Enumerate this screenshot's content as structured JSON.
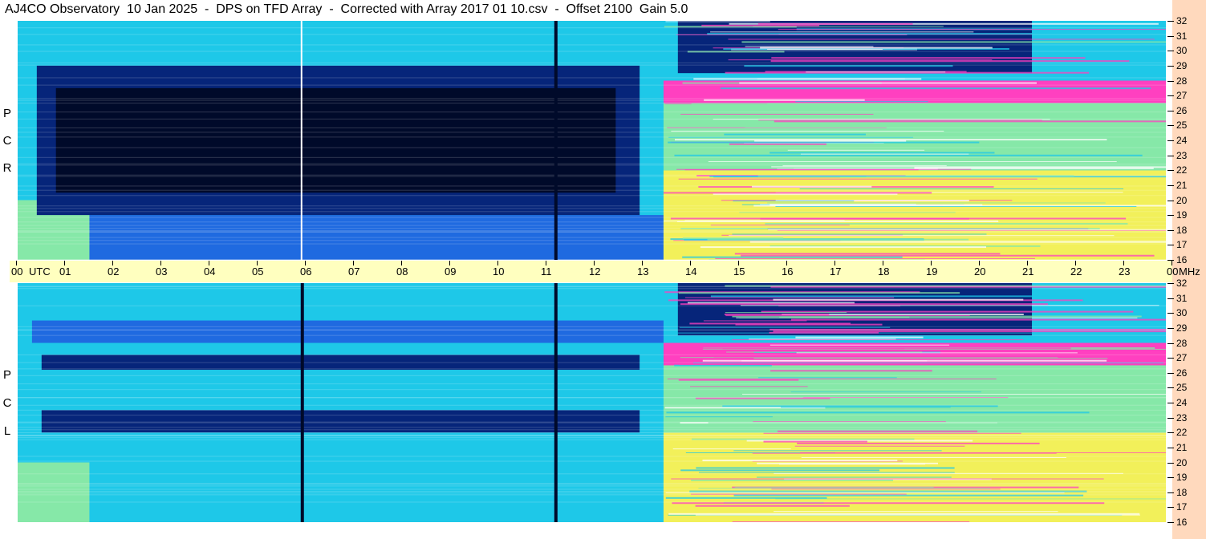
{
  "title": "AJ4CO Observatory  10 Jan 2025  -  DPS on TFD Array  -  Corrected with Array 2017 01 10.csv  -  Offset 2100  Gain 5.0",
  "polarizations": {
    "top": [
      "R",
      "C",
      "P"
    ],
    "bottom": [
      "L",
      "C",
      "P"
    ]
  },
  "time_axis": {
    "labels": [
      "00",
      "01",
      "02",
      "03",
      "04",
      "05",
      "06",
      "07",
      "08",
      "09",
      "10",
      "11",
      "12",
      "13",
      "14",
      "15",
      "16",
      "17",
      "18",
      "19",
      "20",
      "21",
      "22",
      "23",
      "00"
    ],
    "utc_label": "UTC",
    "mhz_label": "MHz"
  },
  "freq_axis": {
    "labels": [
      "32",
      "31",
      "30",
      "29",
      "28",
      "27",
      "26",
      "25",
      "24",
      "23",
      "22",
      "21",
      "20",
      "19",
      "18",
      "17",
      "16"
    ]
  },
  "colors": {
    "background_right": "#ffd9bd",
    "time_bar": "#ffffbf",
    "deep": "#000a2a",
    "dark": "#06257a",
    "blue": "#1f6ae0",
    "cyan": "#1ec8e8",
    "green": "#86e8a8",
    "yellow": "#f2f05a",
    "magenta": "#ff40c0",
    "white": "#ffffff"
  },
  "chart_data": {
    "type": "heatmap",
    "title": "AJ4CO Observatory  10 Jan 2025  -  DPS on TFD Array  -  Corrected with Array 2017 01 10.csv  -  Offset 2100  Gain 5.0",
    "xlabel": "UTC",
    "ylabel": "MHz",
    "x_range": [
      0,
      24
    ],
    "y_range": [
      16,
      32
    ],
    "panels": [
      {
        "name": "RCP",
        "regions": [
          {
            "x0": 0.0,
            "x1": 24.0,
            "y0": 16,
            "y1": 32,
            "level": "cyan"
          },
          {
            "x0": 0.0,
            "x1": 13.5,
            "y0": 16,
            "y1": 19,
            "level": "blue"
          },
          {
            "x0": 0.0,
            "x1": 1.5,
            "y0": 16,
            "y1": 20,
            "level": "green"
          },
          {
            "x0": 0.4,
            "x1": 13.0,
            "y0": 19,
            "y1": 29,
            "level": "dark"
          },
          {
            "x0": 0.8,
            "x1": 12.5,
            "y0": 20.5,
            "y1": 27.5,
            "level": "deep"
          },
          {
            "x0": 13.5,
            "x1": 24.0,
            "y0": 16,
            "y1": 22,
            "level": "yellow"
          },
          {
            "x0": 13.5,
            "x1": 24.0,
            "y0": 22,
            "y1": 26.5,
            "level": "green"
          },
          {
            "x0": 13.8,
            "x1": 21.2,
            "y0": 28.5,
            "y1": 32,
            "level": "dark"
          },
          {
            "x0": 13.5,
            "x1": 24.0,
            "y0": 26.5,
            "y1": 28,
            "level": "magenta"
          }
        ],
        "vertical_lines": [
          {
            "x": 5.95,
            "level": "white"
          },
          {
            "x": 11.25,
            "level": "deep"
          }
        ]
      },
      {
        "name": "LCP",
        "regions": [
          {
            "x0": 0.0,
            "x1": 24.0,
            "y0": 16,
            "y1": 32,
            "level": "cyan"
          },
          {
            "x0": 0.3,
            "x1": 13.5,
            "y0": 28,
            "y1": 29.5,
            "level": "blue"
          },
          {
            "x0": 0.5,
            "x1": 13.0,
            "y0": 26.2,
            "y1": 27.2,
            "level": "dark"
          },
          {
            "x0": 0.5,
            "x1": 13.0,
            "y0": 22,
            "y1": 23.5,
            "level": "dark"
          },
          {
            "x0": 0.0,
            "x1": 1.5,
            "y0": 16,
            "y1": 20,
            "level": "green"
          },
          {
            "x0": 13.5,
            "x1": 24.0,
            "y0": 16,
            "y1": 22,
            "level": "yellow"
          },
          {
            "x0": 13.5,
            "x1": 24.0,
            "y0": 22,
            "y1": 26.5,
            "level": "green"
          },
          {
            "x0": 13.8,
            "x1": 21.2,
            "y0": 28.5,
            "y1": 32,
            "level": "dark"
          },
          {
            "x0": 13.5,
            "x1": 24.0,
            "y0": 26.5,
            "y1": 28,
            "level": "magenta"
          }
        ],
        "vertical_lines": [
          {
            "x": 5.95,
            "level": "deep"
          },
          {
            "x": 11.25,
            "level": "deep"
          }
        ]
      }
    ]
  }
}
